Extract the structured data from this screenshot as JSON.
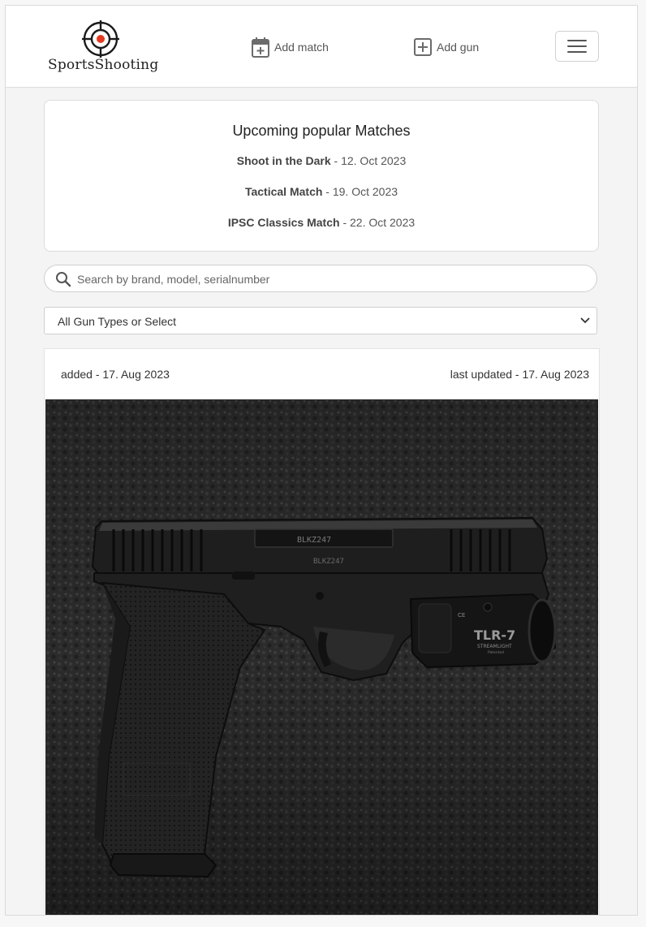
{
  "brand": {
    "name": "SportsShooting",
    "accent_color": "#e53a1e",
    "icon": "crosshair-logo-icon"
  },
  "nav": {
    "add_match_label": "Add match",
    "add_match_icon": "calendar-plus-icon",
    "add_gun_label": "Add gun",
    "add_gun_icon": "plus-square-icon",
    "menu_icon": "hamburger-menu-icon"
  },
  "upcoming": {
    "title": "Upcoming popular Matches",
    "matches": [
      {
        "name": "Shoot in the Dark",
        "date": " - 12. Oct 2023"
      },
      {
        "name": "Tactical Match",
        "date": " - 19. Oct 2023"
      },
      {
        "name": "IPSC Classics Match",
        "date": " - 22. Oct 2023"
      }
    ]
  },
  "search": {
    "placeholder": "Search by brand, model, serialnumber",
    "icon": "search-icon"
  },
  "filter": {
    "selected": "All Gun Types or Select"
  },
  "gun": {
    "added": "added - 17. Aug 2023",
    "updated": "last updated - 17. Aug 2023",
    "slide_serial": "BLKZ247",
    "light_brand": "TLR-7",
    "light_sub": "STREAMLIGHT",
    "light_sub2": "Patented"
  }
}
